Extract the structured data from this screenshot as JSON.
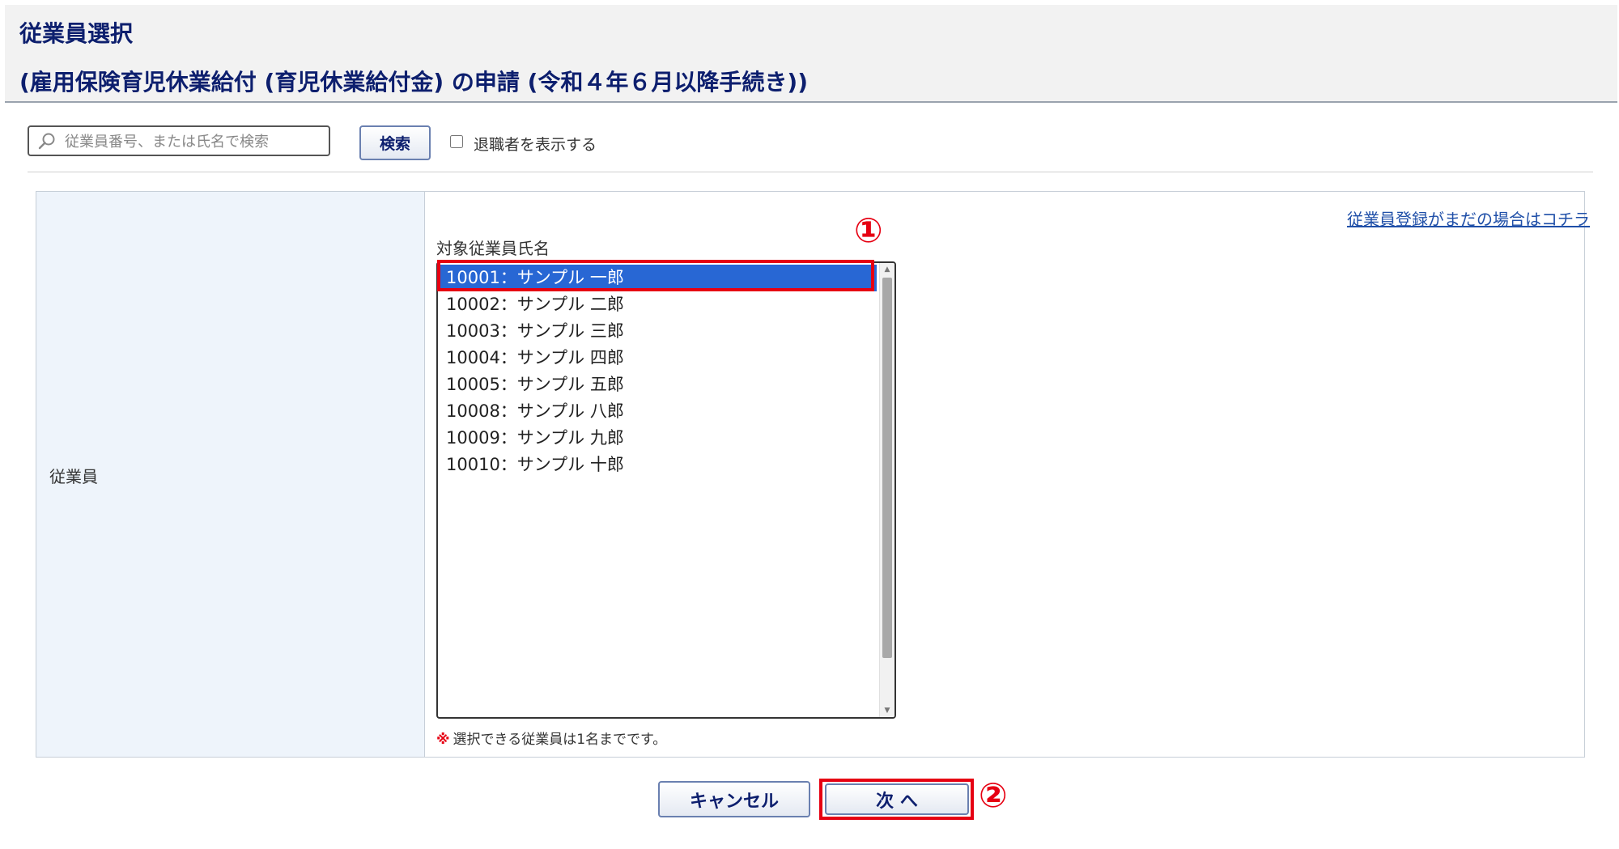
{
  "header": {
    "title": "従業員選択",
    "subtitle": "(雇用保険育児休業給付 (育児休業給付金) の申請 (令和４年６月以降手続き))"
  },
  "search": {
    "placeholder": "従業員番号、または氏名で検索",
    "value": "",
    "button_label": "検索",
    "show_retired_label": "退職者を表示する",
    "show_retired_checked": false
  },
  "form": {
    "row_label": "従業員",
    "register_link": "従業員登録がまだの場合はコチラ",
    "list_label": "対象従業員氏名",
    "employees": [
      {
        "label": "10001：サンプル 一郎",
        "selected": true
      },
      {
        "label": "10002：サンプル 二郎",
        "selected": false
      },
      {
        "label": "10003：サンプル 三郎",
        "selected": false
      },
      {
        "label": "10004：サンプル 四郎",
        "selected": false
      },
      {
        "label": "10005：サンプル 五郎",
        "selected": false
      },
      {
        "label": "10008：サンプル 八郎",
        "selected": false
      },
      {
        "label": "10009：サンプル 九郎",
        "selected": false
      },
      {
        "label": "10010：サンプル 十郎",
        "selected": false
      }
    ],
    "note_mark": "※",
    "note": "選択できる従業員は1名までです。"
  },
  "buttons": {
    "cancel": "キャンセル",
    "next": "次 へ"
  },
  "annotations": {
    "step1": "①",
    "step2": "②",
    "color": "#e60012"
  },
  "colors": {
    "title": "#0d1f6e",
    "selected_bg": "#2867d4",
    "label_cell_bg": "#eef4fb",
    "link": "#1f4fa8"
  }
}
